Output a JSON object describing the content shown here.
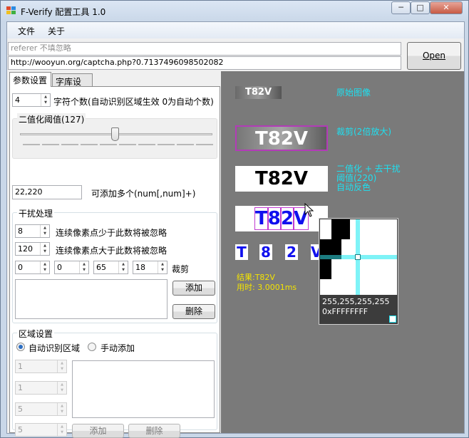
{
  "window": {
    "title": "F-Verify 配置工具 1.0"
  },
  "caption": {
    "minimize": "─",
    "maximize": "□",
    "close": "✕"
  },
  "menu": [
    "文件",
    "关于"
  ],
  "referer_input": {
    "placeholder": "referer 不填忽略"
  },
  "url_input": {
    "value": "http://wooyun.org/captcha.php?0.7137496098502082"
  },
  "open_button": "Open",
  "tabs": [
    "参数设置",
    "字库设置"
  ],
  "params": {
    "char_count": {
      "value": "4",
      "label": "字符个数(自动识别区域生效 0为自动个数)"
    },
    "threshold": {
      "group_title": "二值化阈值(127)",
      "level": 127,
      "max": 255
    },
    "multi": {
      "value": "22,220",
      "label": "可添加多个(num[,num]+)"
    },
    "noise": {
      "group_title": "干扰处理",
      "min_pixels": {
        "value": "8",
        "label": "连续像素点少于此数将被忽略"
      },
      "max_pixels": {
        "value": "120",
        "label": "连续像素点大于此数将被忽略"
      },
      "crop": {
        "values": [
          "0",
          "0",
          "65",
          "18"
        ],
        "label": "裁剪"
      },
      "add_button": "添加",
      "delete_button": "删除"
    },
    "region": {
      "group_title": "区域设置",
      "auto_label": "自动识别区域",
      "manual_label": "手动添加",
      "spins": [
        "1",
        "1",
        "5",
        "5"
      ],
      "add_button": "添加",
      "delete_button": "删除"
    }
  },
  "preview": {
    "captcha_text": "T82V",
    "chars": [
      "T",
      "8",
      "2",
      "V"
    ],
    "original_label": "原始图像",
    "crop_label": "裁剪(2倍放大)",
    "binarize_label": [
      "二值化 + 去干扰",
      "阈值(220)",
      "自动反色"
    ],
    "result_label": "结果:T82V",
    "time_label": "用时: 3.0001ms",
    "magnifier": {
      "rgb": "255,255,255,255",
      "hex": "0xFFFFFFFF"
    }
  },
  "colors": {
    "accent": "#1ee0f0",
    "result": "#f4e400",
    "panel": "#7a7a7a",
    "glyph_blue": "#1010ee"
  }
}
